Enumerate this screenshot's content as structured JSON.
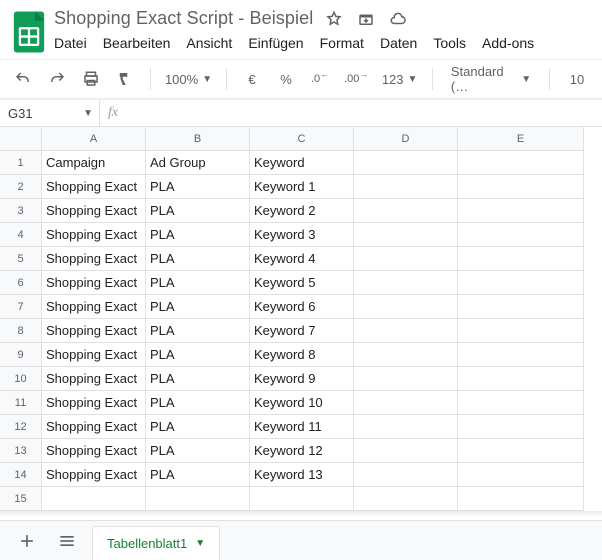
{
  "header": {
    "doc_title": "Shopping Exact Script - Beispiel"
  },
  "menu": [
    "Datei",
    "Bearbeiten",
    "Ansicht",
    "Einfügen",
    "Format",
    "Daten",
    "Tools",
    "Add-ons"
  ],
  "toolbar": {
    "zoom": "100%",
    "currency": "€",
    "percent": "%",
    "dec_less": ".0",
    "dec_more": ".00",
    "more_formats": "123",
    "font": "Standard (…",
    "font_size": "10"
  },
  "fx": {
    "namebox": "G31",
    "fx_label": "fx",
    "formula": ""
  },
  "columns": [
    "A",
    "B",
    "C",
    "D",
    "E"
  ],
  "col_widths": [
    "cA",
    "cB",
    "cC",
    "cD",
    "cE"
  ],
  "rows": [
    {
      "n": "1",
      "cells": [
        "Campaign",
        "Ad Group",
        "Keyword",
        "",
        ""
      ]
    },
    {
      "n": "2",
      "cells": [
        "Shopping Exact",
        "PLA",
        "Keyword 1",
        "",
        ""
      ]
    },
    {
      "n": "3",
      "cells": [
        "Shopping Exact",
        "PLA",
        "Keyword 2",
        "",
        ""
      ]
    },
    {
      "n": "4",
      "cells": [
        "Shopping Exact",
        "PLA",
        "Keyword 3",
        "",
        ""
      ]
    },
    {
      "n": "5",
      "cells": [
        "Shopping Exact",
        "PLA",
        "Keyword 4",
        "",
        ""
      ]
    },
    {
      "n": "6",
      "cells": [
        "Shopping Exact",
        "PLA",
        "Keyword 5",
        "",
        ""
      ]
    },
    {
      "n": "7",
      "cells": [
        "Shopping Exact",
        "PLA",
        "Keyword 6",
        "",
        ""
      ]
    },
    {
      "n": "8",
      "cells": [
        "Shopping Exact",
        "PLA",
        "Keyword 7",
        "",
        ""
      ]
    },
    {
      "n": "9",
      "cells": [
        "Shopping Exact",
        "PLA",
        "Keyword 8",
        "",
        ""
      ]
    },
    {
      "n": "10",
      "cells": [
        "Shopping Exact",
        "PLA",
        "Keyword 9",
        "",
        ""
      ]
    },
    {
      "n": "11",
      "cells": [
        "Shopping Exact",
        "PLA",
        "Keyword 10",
        "",
        ""
      ]
    },
    {
      "n": "12",
      "cells": [
        "Shopping Exact",
        "PLA",
        "Keyword 11",
        "",
        ""
      ]
    },
    {
      "n": "13",
      "cells": [
        "Shopping Exact",
        "PLA",
        "Keyword 12",
        "",
        ""
      ]
    },
    {
      "n": "14",
      "cells": [
        "Shopping Exact",
        "PLA",
        "Keyword 13",
        "",
        ""
      ]
    },
    {
      "n": "15",
      "cells": [
        "",
        "",
        "",
        "",
        ""
      ]
    }
  ],
  "sheet": {
    "tab_name": "Tabellenblatt1"
  }
}
